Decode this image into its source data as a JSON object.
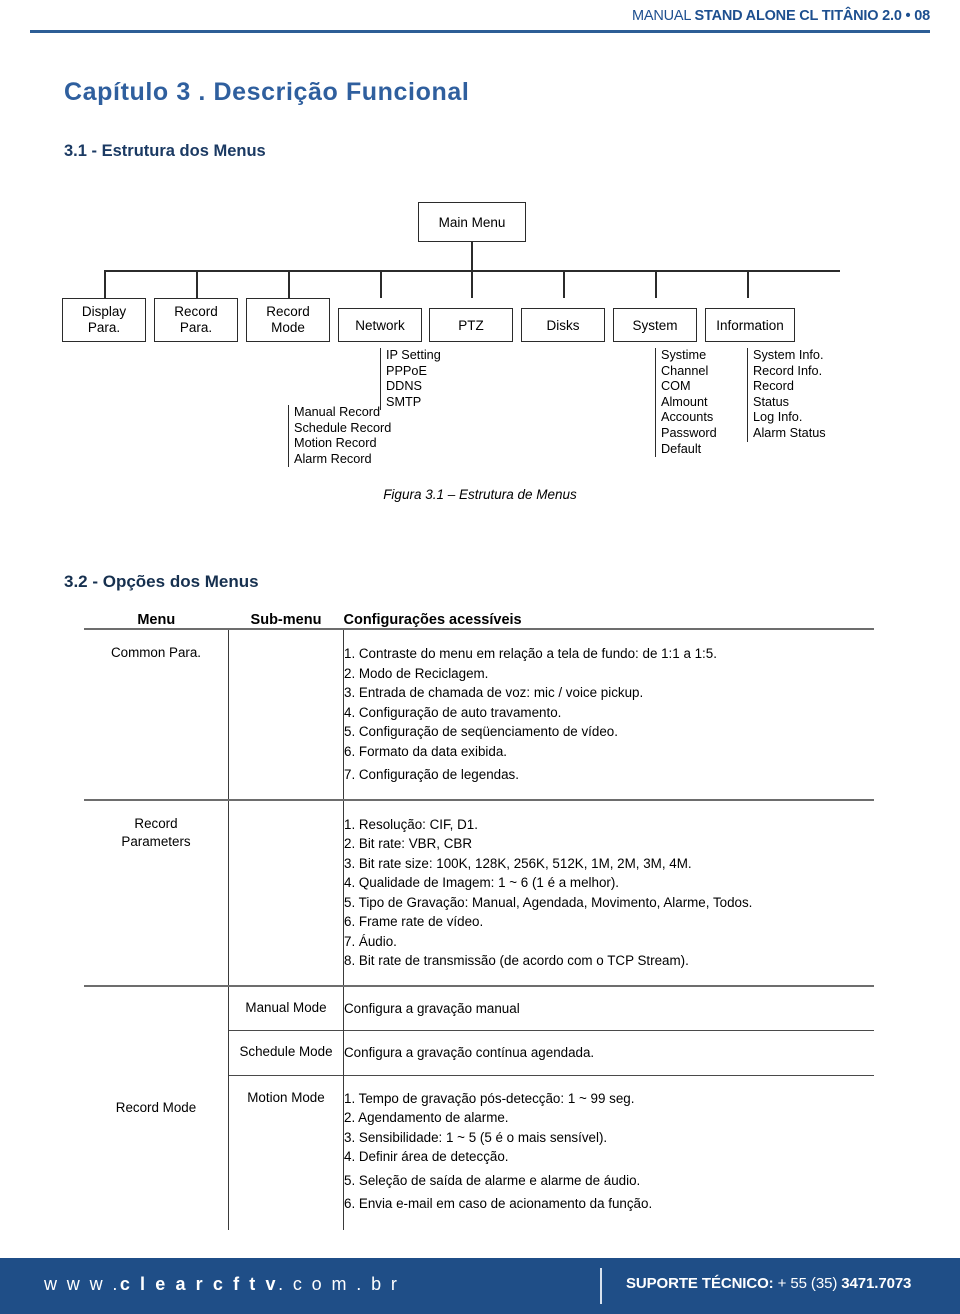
{
  "header": {
    "manual_word": "MANUAL",
    "title_bold": "STAND ALONE CL TITÂNIO 2.0 • 08"
  },
  "chapter": {
    "title": "Capítulo 3 . Descrição Funcional",
    "section_1": "3.1 - Estrutura dos Menus",
    "section_2": "3.2 - Opções dos Menus"
  },
  "diagram": {
    "root": "Main Menu",
    "caption": "Figura 3.1 – Estrutura de Menus",
    "nodes": [
      {
        "label_line1": "Display",
        "label_line2": "Para."
      },
      {
        "label_line1": "Record",
        "label_line2": "Para."
      },
      {
        "label_line1": "Record",
        "label_line2": "Mode"
      },
      {
        "label_line1": "Network",
        "label_line2": ""
      },
      {
        "label_line1": "PTZ",
        "label_line2": ""
      },
      {
        "label_line1": "Disks",
        "label_line2": ""
      },
      {
        "label_line1": "System",
        "label_line2": ""
      },
      {
        "label_line1": "Information",
        "label_line2": ""
      }
    ],
    "sub_record_mode": [
      "Manual Record",
      "Schedule Record",
      "Motion Record",
      "Alarm Record"
    ],
    "sub_network": [
      "IP Setting",
      "PPPoE",
      "DDNS",
      "SMTP"
    ],
    "sub_system": [
      "Systime",
      "Channel",
      "COM",
      "Almount",
      "Accounts",
      "Password",
      "Default"
    ],
    "sub_information": [
      "System Info.",
      "Record Info.",
      "Record",
      "Status",
      "Log Info.",
      "Alarm Status"
    ]
  },
  "table": {
    "headers": {
      "menu": "Menu",
      "submenu": "Sub-menu",
      "config": "Configurações acessíveis"
    },
    "rows": [
      {
        "menu": "Common Para.",
        "submenu": "",
        "items": [
          "1. Contraste do menu em relação a tela de fundo: de 1:1 a 1:5.",
          "2. Modo de Reciclagem.",
          "3. Entrada de chamada de voz: mic / voice pickup.",
          "4. Configuração de auto travamento.",
          "5. Configuração de seqüenciamento de vídeo.",
          "6. Formato da data exibida.",
          "7. Configuração de legendas."
        ]
      },
      {
        "menu_line1": "Record",
        "menu_line2": "Parameters",
        "submenu": "",
        "items": [
          "1. Resolução: CIF, D1.",
          "2. Bit rate: VBR, CBR",
          "3. Bit rate size: 100K, 128K, 256K, 512K,  1M, 2M, 3M, 4M.",
          "4. Qualidade de Imagem: 1 ~ 6 (1 é a melhor).",
          "5. Tipo de Gravação: Manual, Agendada, Movimento, Alarme, Todos.",
          "6. Frame rate de vídeo.",
          "7. Áudio.",
          "8. Bit rate de transmissão (de acordo com o TCP Stream)."
        ]
      },
      {
        "menu": "Record Mode",
        "subrows": [
          {
            "submenu": "Manual Mode",
            "items": [
              "Configura a gravação manual"
            ]
          },
          {
            "submenu": "Schedule Mode",
            "items": [
              "Configura a gravação contínua agendada."
            ]
          },
          {
            "submenu": "Motion Mode",
            "items": [
              "1. Tempo de gravação pós-detecção: 1 ~ 99 seg.",
              "2. Agendamento de alarme.",
              "3. Sensibilidade: 1 ~ 5 (5 é o mais sensível).",
              "4. Definir área de detecção.",
              "5. Seleção de saída de alarme e alarme de áudio.",
              "6. Envia e-mail em caso de acionamento da função."
            ]
          }
        ]
      }
    ]
  },
  "footer": {
    "url_prefix": "w w w .",
    "url_brand": "c l e a r c f t v",
    "url_suffix": ". c o m . b r",
    "support_label": "SUPORTE TÉCNICO:",
    "support_mid": "+ 55 (35)",
    "support_number": "3471.7073"
  }
}
